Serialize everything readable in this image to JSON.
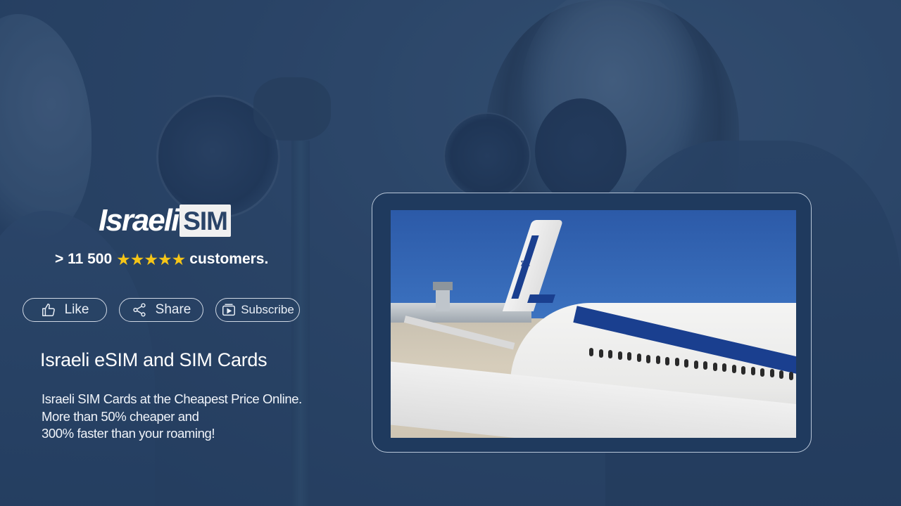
{
  "brand": {
    "logo_text_main": "Israeli",
    "logo_text_box": "SIM",
    "colors": {
      "background": "#2a4468",
      "stars": "#f5c518",
      "frame_border": "#b8c6d8"
    }
  },
  "rating": {
    "count": "> 11 500",
    "stars": "★★★★★",
    "suffix": "customers."
  },
  "actions": {
    "like_label": "Like",
    "share_label": "Share",
    "subscribe_label": "Subscribe",
    "icons": {
      "like": "thumbs-up-icon",
      "share": "share-icon",
      "subscribe": "subscribe-icon"
    }
  },
  "content": {
    "headline": "Israeli eSIM and SIM Cards",
    "description_lines": [
      "Israeli SIM Cards at the Cheapest Price Online.",
      "More than 50% cheaper and",
      "300% faster than your roaming!"
    ]
  },
  "video": {
    "subject": "airplane-on-tarmac-image"
  }
}
